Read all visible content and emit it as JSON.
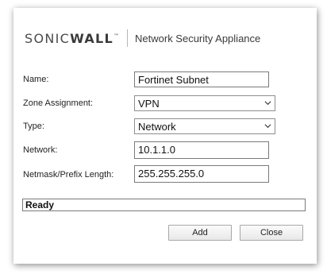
{
  "header": {
    "logo_part1": "SONIC",
    "logo_part2": "WALL",
    "logo_tm": "™",
    "product_name": "Network Security Appliance"
  },
  "form": {
    "name_label": "Name:",
    "name_value": "Fortinet Subnet",
    "zone_label": "Zone Assignment:",
    "zone_value": "VPN",
    "type_label": "Type:",
    "type_value": "Network",
    "network_label": "Network:",
    "network_value": "10.1.1.0",
    "netmask_label": "Netmask/Prefix Length:",
    "netmask_value": "255.255.255.0"
  },
  "status": {
    "text": "Ready"
  },
  "buttons": {
    "add_label": "Add",
    "close_label": "Close"
  },
  "icons": {
    "dropdown": "chevron-down-icon"
  }
}
